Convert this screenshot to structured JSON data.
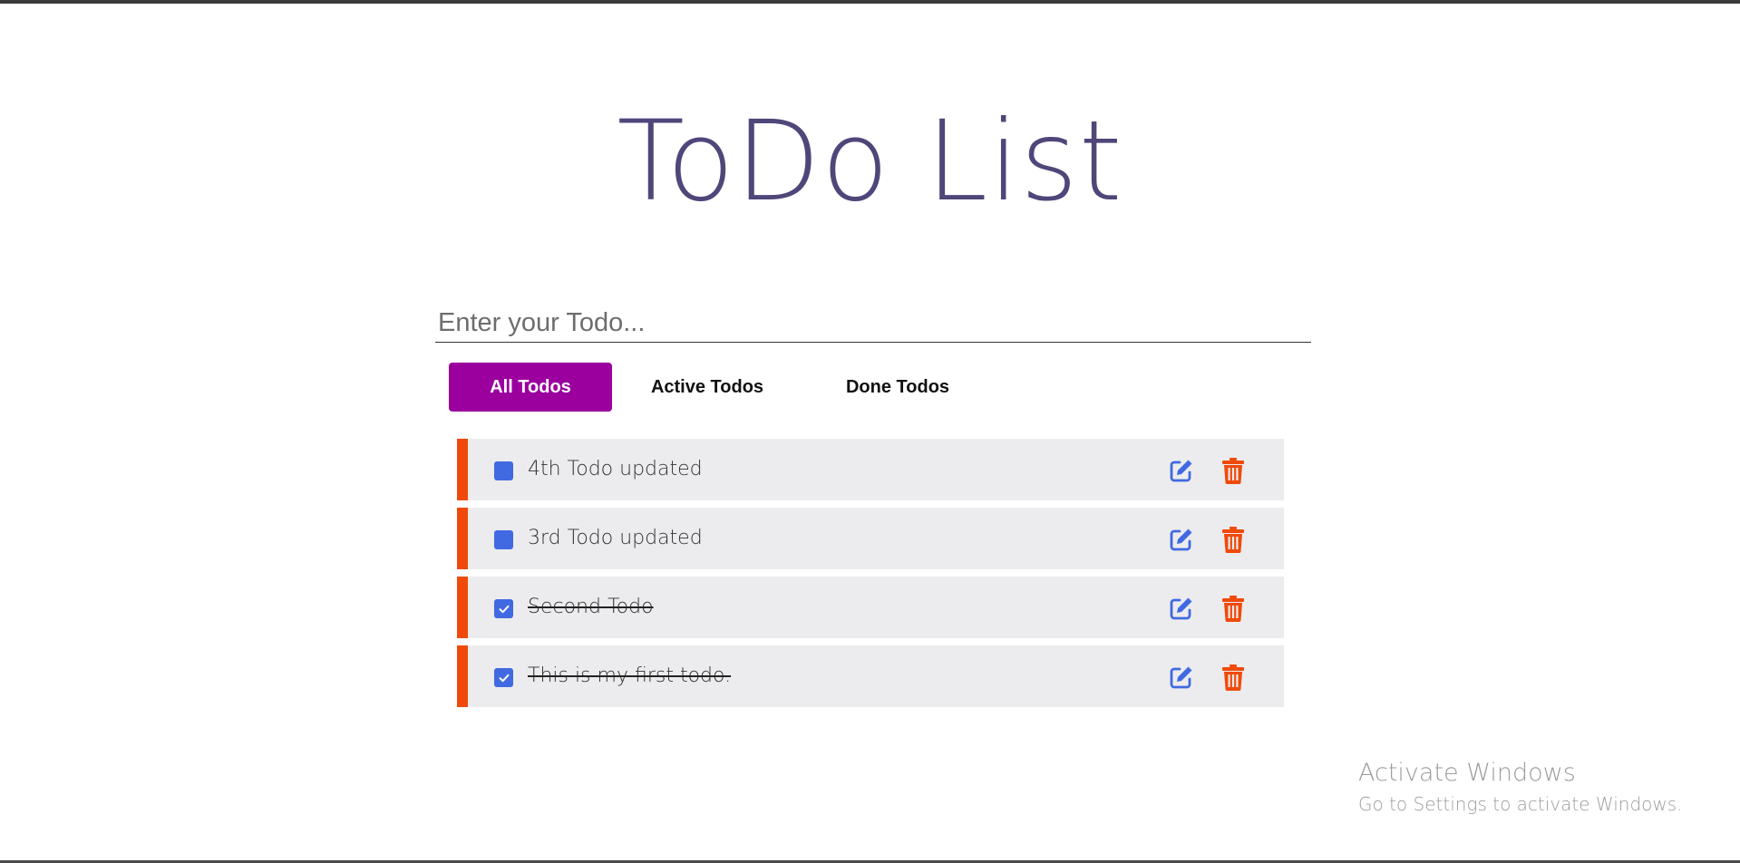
{
  "title": "ToDo List",
  "input": {
    "placeholder": "Enter your Todo...",
    "value": ""
  },
  "filters": {
    "all": "All Todos",
    "active": "Active Todos",
    "done": "Done Todos",
    "selected": "All Todos"
  },
  "todos": [
    {
      "text": "4th Todo updated",
      "done": false
    },
    {
      "text": "3rd Todo updated",
      "done": false
    },
    {
      "text": "Second Todo",
      "done": true
    },
    {
      "text": "This is my first todo.",
      "done": true
    }
  ],
  "colors": {
    "title": "#504679",
    "active_tab": "#9b009f",
    "accent": "#f04a0a",
    "checkbox": "#4169e1",
    "edit_icon": "#4169e1",
    "delete_icon": "#f04a0a",
    "row_background": "#ececee"
  },
  "icons": {
    "edit": "edit-icon",
    "delete": "trash-icon",
    "checked": "check-icon"
  },
  "watermark": {
    "title": "Activate Windows",
    "subtitle": "Go to Settings to activate Windows."
  }
}
